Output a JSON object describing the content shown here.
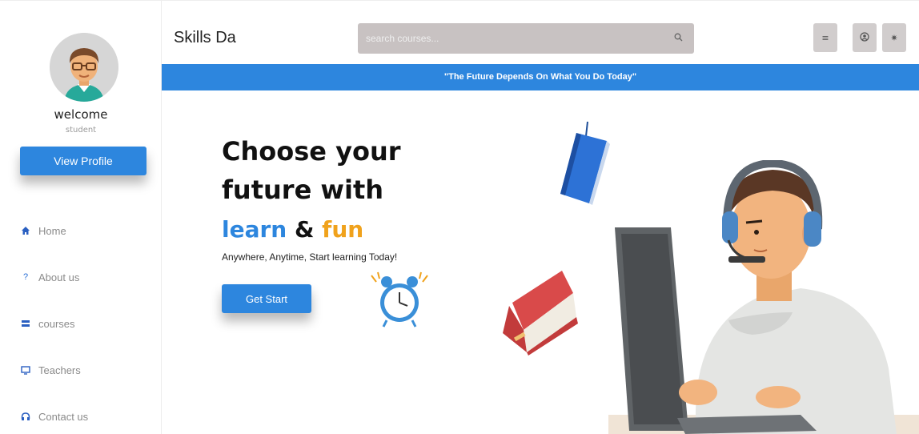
{
  "sidebar": {
    "welcome": "welcome",
    "role": "student",
    "view_profile": "View Profile",
    "items": [
      {
        "label": "Home",
        "icon": "home-icon"
      },
      {
        "label": "About us",
        "icon": "question-icon"
      },
      {
        "label": "courses",
        "icon": "stack-icon"
      },
      {
        "label": "Teachers",
        "icon": "monitor-icon"
      },
      {
        "label": "Contact us",
        "icon": "headphones-icon"
      }
    ]
  },
  "header": {
    "brand": "Skills Da",
    "search_placeholder": "search courses...",
    "buttons": [
      "menu-icon",
      "user-icon",
      "sun-icon"
    ]
  },
  "quote": "\"The Future Depends On What You Do Today\"",
  "hero": {
    "line1": "Choose your",
    "line2": "future with",
    "learn": "learn",
    "amp": "&",
    "fun": "fun",
    "tagline": "Anywhere, Anytime, Start learning Today!",
    "cta": "Get Start"
  },
  "colors": {
    "accent": "#2d86de",
    "fun": "#f0a21c",
    "search_bg": "#c8c2c2"
  }
}
